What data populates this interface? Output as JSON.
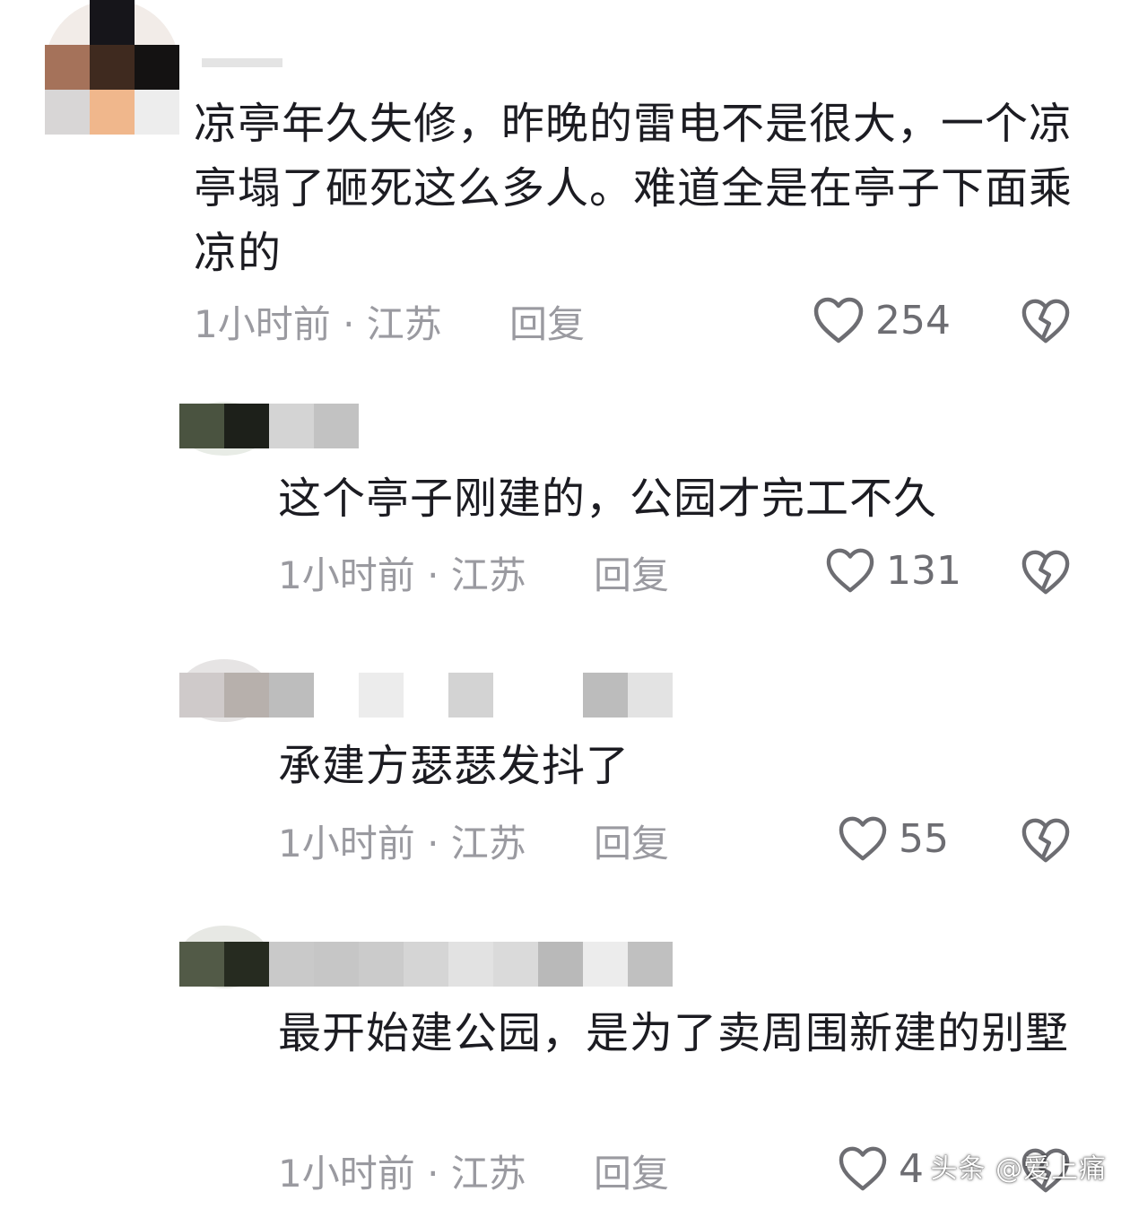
{
  "comments": [
    {
      "text": "凉亭年久失修，昨晚的雷电不是很大，一个凉亭塌了砸死这么多人。难道全是在亭子下面乘凉的",
      "time_location": "1小时前 · 江苏",
      "reply_label": "回复",
      "likes": "254"
    },
    {
      "text": "这个亭子刚建的，公园才完工不久",
      "time_location": "1小时前 · 江苏",
      "reply_label": "回复",
      "likes": "131"
    },
    {
      "text": "承建方瑟瑟发抖了",
      "time_location": "1小时前 · 江苏",
      "reply_label": "回复",
      "likes": "55"
    },
    {
      "text": "最开始建公园，是为了卖周围新建的别墅",
      "time_location": "1小时前 · 江苏",
      "reply_label": "回复",
      "likes": "4"
    }
  ],
  "icons": {
    "like": "heart-outline-icon",
    "dislike": "broken-heart-icon"
  },
  "colors": {
    "text": "#1c1c22",
    "meta": "#9a9aa0",
    "icon": "#6d6d72"
  },
  "watermark": "头条 @爱上痛"
}
